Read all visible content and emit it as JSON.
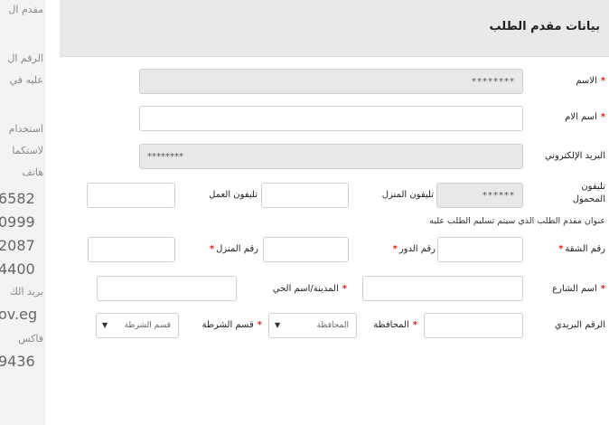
{
  "sidebar": {
    "lines": [
      "مقدم ال",
      "الرقم ال",
      "عليه في",
      "استخدام",
      "لاستكما",
      "هاتف",
      "6582",
      "0999",
      "2087",
      "4400",
      "بريد الك",
      "ov.eg",
      "فاكس",
      "9436"
    ]
  },
  "panel": {
    "title": "بيانات مقدم الطلب"
  },
  "form": {
    "name": {
      "label": "الاسم",
      "value": "********"
    },
    "mother_name": {
      "label": "اسم الام",
      "value": ""
    },
    "email": {
      "label": "البريد الإلكتروني",
      "value": "********"
    },
    "mobile": {
      "label": "تليفون المحمول",
      "value": "******"
    },
    "home_phone": {
      "label": "تليفون المنزل",
      "value": ""
    },
    "work_phone": {
      "label": "تليفون العمل",
      "value": ""
    },
    "delivery_note": "عنوان مقدم الطلب الذي سيتم تسليم الطلب عليه",
    "apartment": {
      "label": "رقم الشقة",
      "value": ""
    },
    "floor": {
      "label": "رقم الدور",
      "value": ""
    },
    "house": {
      "label": "رقم المنزل",
      "value": ""
    },
    "street": {
      "label": "اسم الشارع",
      "value": ""
    },
    "district": {
      "label": "المدينة/اسم الحي",
      "value": ""
    },
    "postal": {
      "label": "الرقم البريدي",
      "value": ""
    },
    "governorate": {
      "label": "المحافظة",
      "selected": "المحافظة"
    },
    "police": {
      "label": "قسم الشرطة",
      "selected": "قسم الشرطة"
    }
  },
  "colors": {
    "required": "#d9221c",
    "readonly_bg": "#e8e8e6",
    "header_bg": "#e9e9e9"
  }
}
